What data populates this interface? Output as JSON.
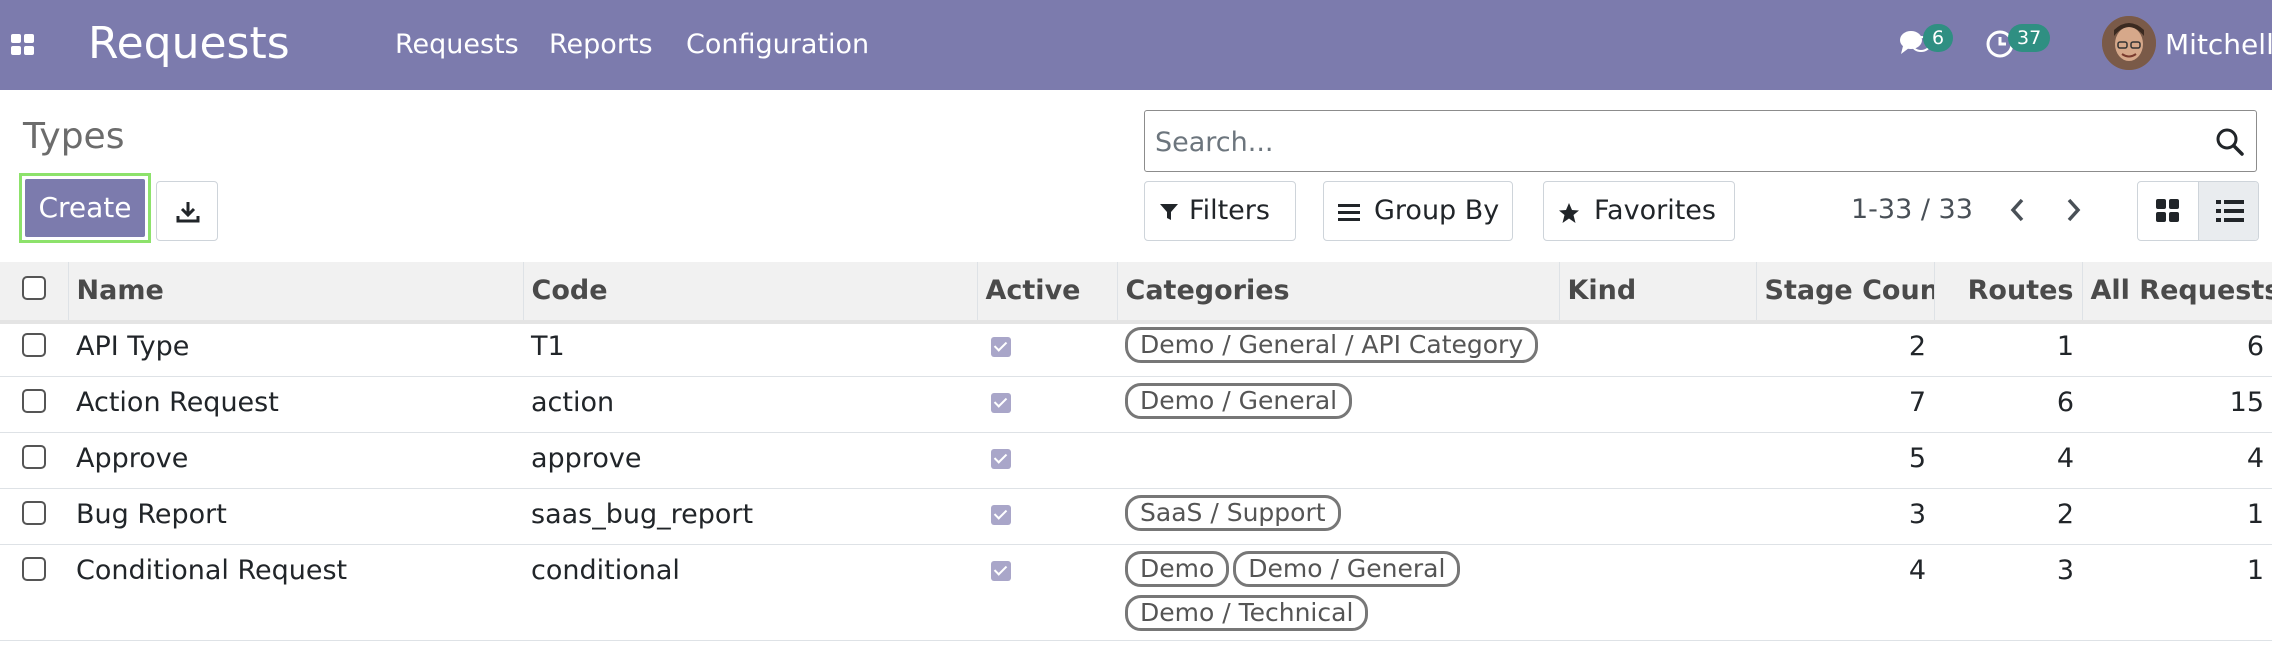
{
  "navbar": {
    "app_title": "Requests",
    "menu": [
      "Requests",
      "Reports",
      "Configuration"
    ],
    "messages_count": "6",
    "activities_count": "37",
    "user_name": "Mitchell",
    "color": "#7c7bad"
  },
  "control_panel": {
    "title": "Types",
    "create_label": "Create",
    "search_placeholder": "Search...",
    "filters_label": "Filters",
    "group_by_label": "Group By",
    "favorites_label": "Favorites",
    "pager_value": "1-33 / 33"
  },
  "table": {
    "columns": {
      "name": "Name",
      "code": "Code",
      "active": "Active",
      "categories": "Categories",
      "kind": "Kind",
      "stage_count": "Stage Count",
      "routes": "Routes",
      "all_requests": "All Requests"
    },
    "rows": [
      {
        "name": "API Type",
        "code": "T1",
        "active": true,
        "categories": [
          "Demo / General / API Category"
        ],
        "kind": "",
        "stage_count": "2",
        "routes": "1",
        "all_requests": "6"
      },
      {
        "name": "Action Request",
        "code": "action",
        "active": true,
        "categories": [
          "Demo / General"
        ],
        "kind": "",
        "stage_count": "7",
        "routes": "6",
        "all_requests": "15"
      },
      {
        "name": "Approve",
        "code": "approve",
        "active": true,
        "categories": [],
        "kind": "",
        "stage_count": "5",
        "routes": "4",
        "all_requests": "4"
      },
      {
        "name": "Bug Report",
        "code": "saas_bug_report",
        "active": true,
        "categories": [
          "SaaS / Support"
        ],
        "kind": "",
        "stage_count": "3",
        "routes": "2",
        "all_requests": "1"
      },
      {
        "name": "Conditional Request",
        "code": "conditional",
        "active": true,
        "categories": [
          "Demo",
          "Demo / General",
          "Demo / Technical"
        ],
        "kind": "",
        "stage_count": "4",
        "routes": "3",
        "all_requests": "1"
      }
    ]
  }
}
